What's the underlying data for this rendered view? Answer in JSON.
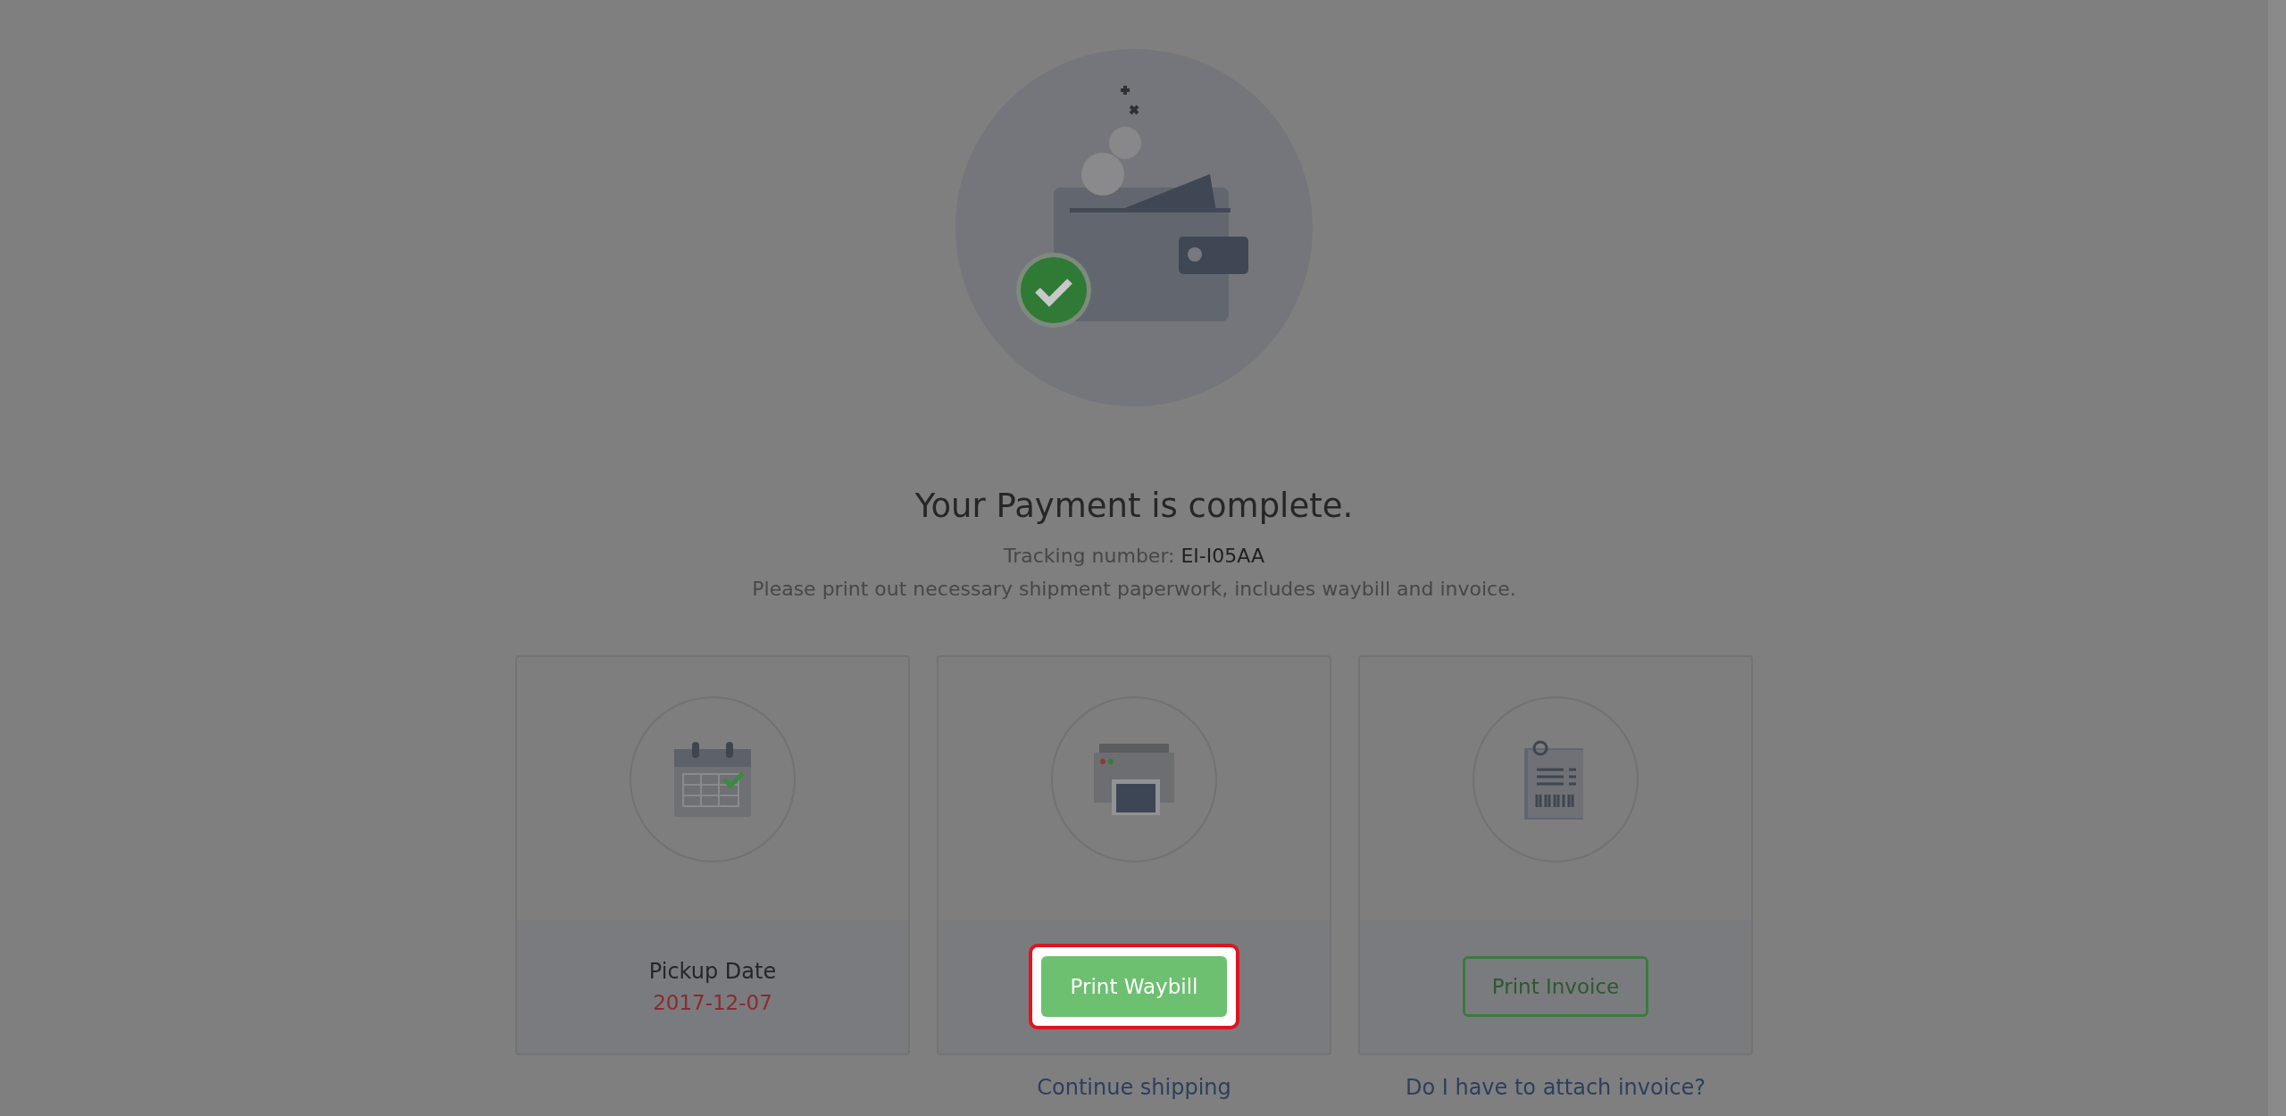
{
  "heading": "Your Payment is complete.",
  "tracking": {
    "label": "Tracking number:",
    "value": "EI-I05AA"
  },
  "instructions": "Please print out necessary shipment paperwork, includes waybill and invoice.",
  "cards": [
    {
      "kind": "date",
      "label": "Pickup Date",
      "value": "2017-12-07"
    },
    {
      "kind": "primary",
      "button": "Print Waybill",
      "highlighted": true,
      "link": "Continue shipping"
    },
    {
      "kind": "outline",
      "button": "Print Invoice",
      "highlighted": false,
      "link": "Do I have to attach invoice?"
    }
  ]
}
